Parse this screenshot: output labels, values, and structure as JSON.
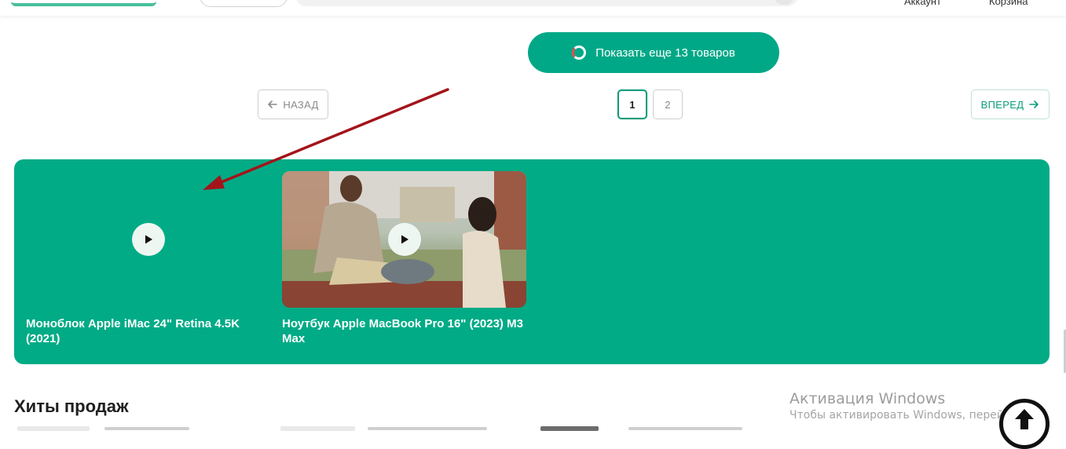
{
  "header": {
    "account_label": "Аккаунт",
    "cart_label": "Корзина"
  },
  "load_more": {
    "label": "Показать еще 13 товаров"
  },
  "pagination": {
    "prev_label": "НАЗАД",
    "next_label": "ВПЕРЕД",
    "pages": [
      "1",
      "2"
    ],
    "active_page": "1"
  },
  "video_banner": {
    "items": [
      {
        "title": "Моноблок Apple iMac 24\" Retina 4.5K (2021)",
        "thumbnail": "empty"
      },
      {
        "title": "Ноутбук Apple MacBook Pro 16\" (2023) M3 Max",
        "thumbnail": "photo"
      }
    ]
  },
  "section": {
    "title": "Хиты продаж"
  },
  "windows_watermark": {
    "title": "Активация Windows",
    "subtitle": "Чтобы активировать Windows, перейдите в"
  },
  "colors": {
    "brand_green": "#00ab86",
    "button_green": "#00a887",
    "annotation_red": "#a3141a"
  },
  "icons": {
    "play": "play-icon",
    "prev": "arrow-left-icon",
    "next": "arrow-right-icon",
    "scroll_top": "arrow-up-icon",
    "spinner": "loading-spinner-icon"
  }
}
